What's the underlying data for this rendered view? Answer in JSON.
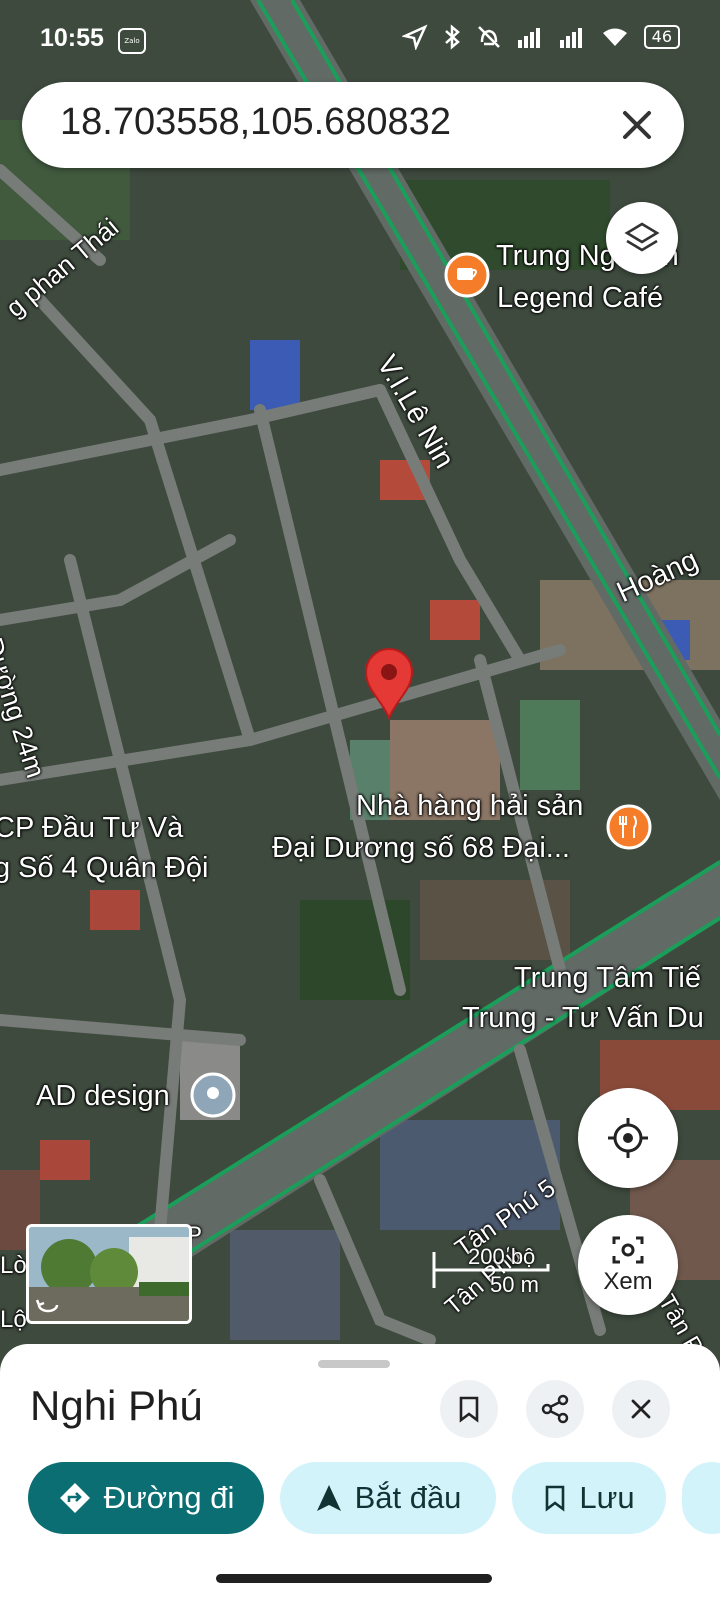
{
  "status_bar": {
    "time": "10:55",
    "app_badge": "Zalo",
    "battery": "46"
  },
  "search": {
    "query": "18.703558,105.680832"
  },
  "map": {
    "labels": {
      "trung_nguyen_line1": "Trung Nguyên",
      "trung_nguyen_line2": "Legend Café",
      "le_nin": "V.I.Lê Nin",
      "phan_thai": "g phan Thái",
      "hoang": "Hoàng",
      "duong_24m": "Đường 24m",
      "cp_line1": "CP Đầu Tư Và",
      "cp_line2": "g Số 4 Quân Đội",
      "nha_hang_line1": "Nhà hàng hải sản",
      "nha_hang_line2": "Đại Dương số 68 Đại...",
      "trung_tam_line1": "Trung Tâm Tiế",
      "trung_tam_line2": "Trung - Tư Vấn Du",
      "ad_design": "AD design",
      "tan_phu_5": "Tân Phú 5",
      "tan_phu_a": "Tân Phú",
      "tan_phu_b": "Tân P",
      "lo": "Lò",
      "p": "P",
      "lo2": "Lộ"
    },
    "scale": {
      "imperial": "200 bộ",
      "metric": "50 m"
    },
    "accent": "#1a9e5a",
    "pin_color": "#e53935"
  },
  "xem_label": "Xem",
  "sheet": {
    "title": "Nghi Phú",
    "chips": [
      {
        "label": "Đường đi",
        "icon": "directions-icon"
      },
      {
        "label": "Bắt đầu",
        "icon": "navigation-arrow-icon"
      },
      {
        "label": "Lưu",
        "icon": "bookmark-icon"
      }
    ]
  }
}
